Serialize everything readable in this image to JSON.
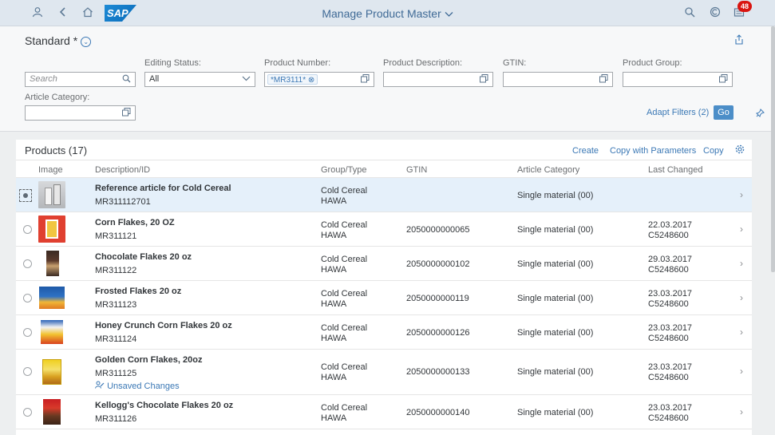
{
  "shell": {
    "title": "Manage Product Master",
    "brand": "SAP",
    "notification_count": "48",
    "icons": [
      "user-icon",
      "back-icon",
      "home-icon",
      "search-icon",
      "copilot-icon",
      "notifications-icon"
    ]
  },
  "filterbar": {
    "variant": "Standard *",
    "search_placeholder": "Search",
    "fields": {
      "editing_status": {
        "label": "Editing Status:",
        "value": "All"
      },
      "product_number": {
        "label": "Product Number:",
        "token": "*MR3111*"
      },
      "product_description": {
        "label": "Product Description:"
      },
      "gtin": {
        "label": "GTIN:"
      },
      "product_group": {
        "label": "Product Group:"
      },
      "article_category": {
        "label": "Article Category:"
      }
    },
    "adapt_filters": "Adapt Filters (2)",
    "go": "Go"
  },
  "table": {
    "title": "Products (17)",
    "actions": {
      "create": "Create",
      "copy_params": "Copy with Parameters",
      "copy": "Copy"
    },
    "columns": [
      "Image",
      "Description/ID",
      "Group/Type",
      "GTIN",
      "Article Category",
      "Last Changed"
    ],
    "rows": [
      {
        "desc": "Reference article for Cold Cereal",
        "id": "MR311112701",
        "group": "Cold Cereal",
        "type": "HAWA",
        "gtin": "",
        "category": "Single material (00)",
        "date": "",
        "user": "",
        "selected": true
      },
      {
        "desc": "Corn Flakes, 20 OZ",
        "id": "MR311121",
        "group": "Cold Cereal",
        "type": "HAWA",
        "gtin": "2050000000065",
        "category": "Single material (00)",
        "date": "22.03.2017",
        "user": "C5248600"
      },
      {
        "desc": "Chocolate Flakes 20 oz",
        "id": "MR311122",
        "group": "Cold Cereal",
        "type": "HAWA",
        "gtin": "2050000000102",
        "category": "Single material (00)",
        "date": "29.03.2017",
        "user": "C5248600"
      },
      {
        "desc": "Frosted Flakes 20 oz",
        "id": "MR311123",
        "group": "Cold Cereal",
        "type": "HAWA",
        "gtin": "2050000000119",
        "category": "Single material (00)",
        "date": "23.03.2017",
        "user": "C5248600"
      },
      {
        "desc": "Honey Crunch Corn Flakes 20 oz",
        "id": "MR311124",
        "group": "Cold Cereal",
        "type": "HAWA",
        "gtin": "2050000000126",
        "category": "Single material (00)",
        "date": "23.03.2017",
        "user": "C5248600"
      },
      {
        "desc": "Golden Corn Flakes, 20oz",
        "id": "MR311125",
        "unsaved": "Unsaved Changes",
        "group": "Cold Cereal",
        "type": "HAWA",
        "gtin": "2050000000133",
        "category": "Single material (00)",
        "date": "23.03.2017",
        "user": "C5248600"
      },
      {
        "desc": "Kellogg's Chocolate Flakes 20 oz",
        "id": "MR311126",
        "group": "Cold Cereal",
        "type": "HAWA",
        "gtin": "2050000000140",
        "category": "Single material (00)",
        "date": "23.03.2017",
        "user": "C5248600"
      }
    ]
  },
  "colors": {
    "shell_bg": "#dfe7ef",
    "link": "#3b78b5",
    "go_button": "#4c8ec8",
    "badge": "#d9140f",
    "selected_row": "#e5f0fa"
  }
}
